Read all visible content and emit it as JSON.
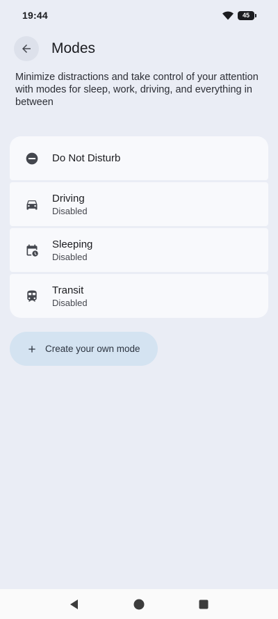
{
  "status_bar": {
    "time": "19:44",
    "battery_level": "45",
    "icons": [
      "wifi-icon",
      "battery-icon"
    ]
  },
  "header": {
    "title": "Modes",
    "back_icon": "arrow-back-icon"
  },
  "description": "Minimize distractions and take control of your attention with modes for sleep, work, driving, and everything in between",
  "modes": [
    {
      "title": "Do Not Disturb",
      "status": "",
      "icon": "do-not-disturb-icon"
    },
    {
      "title": "Driving",
      "status": "Disabled",
      "icon": "car-icon"
    },
    {
      "title": "Sleeping",
      "status": "Disabled",
      "icon": "calendar-clock-icon"
    },
    {
      "title": "Transit",
      "status": "Disabled",
      "icon": "train-icon"
    }
  ],
  "create_button": {
    "label": "Create your own mode",
    "icon": "plus-icon"
  },
  "navigation": {
    "back": "back-triangle-icon",
    "home": "home-circle-icon",
    "recents": "recents-square-icon"
  },
  "colors": {
    "background": "#eaedf5",
    "card": "#f8f9fc",
    "create_button": "#d4e3f1",
    "icon": "#44474e"
  }
}
